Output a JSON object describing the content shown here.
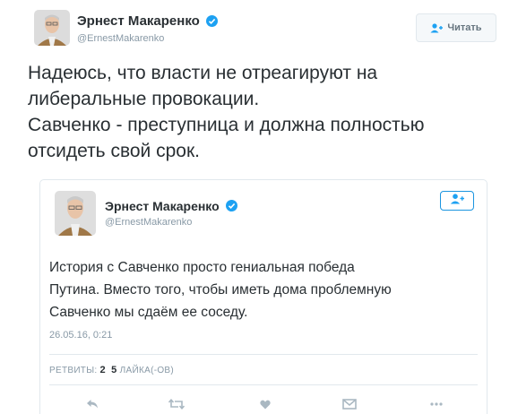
{
  "outer_tweet": {
    "author_name": "Эрнест Макаренко",
    "handle": "@ErnestMakarenko",
    "follow_label": "Читать",
    "text_lines": [
      "Надеюсь, что власти не отреагируют на",
      "либеральные провокации.",
      "Савченко - преступница и должна полностью",
      "отсидеть свой срок."
    ]
  },
  "quoted_tweet": {
    "author_name": "Эрнест Макаренко",
    "handle": "@ErnestMakarenko",
    "text_lines": [
      "История с Савченко просто гениальная победа",
      "Путина. Вместо того, чтобы иметь дома проблемную",
      "Савченко мы сдаём ее соседу."
    ],
    "timestamp": "26.05.16, 0:21",
    "retweets_label": "РЕТВИТЫ:",
    "retweets_count": "2",
    "likes_count": "5",
    "likes_label": "ЛАЙКА(-ОВ)"
  },
  "icons": [
    "reply-icon",
    "retweet-icon",
    "like-icon",
    "dm-icon",
    "more-icon",
    "verified-icon",
    "follow-icon"
  ],
  "colors": {
    "accent": "#1da1f2",
    "text": "#292f33",
    "muted": "#8899a6",
    "border": "#e1e8ed"
  }
}
